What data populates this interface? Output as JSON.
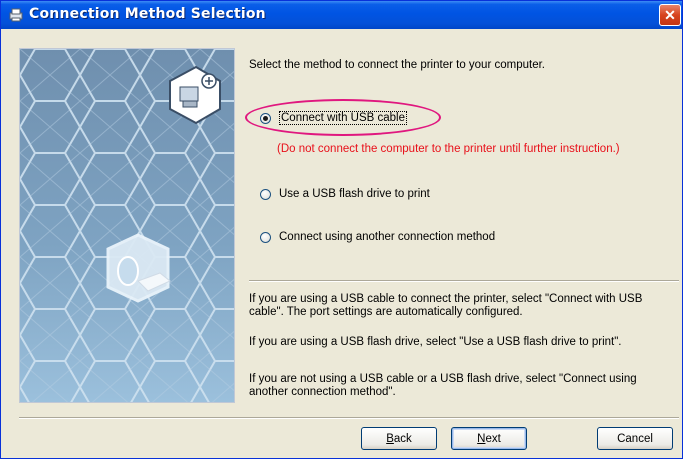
{
  "window": {
    "title": "Connection Method Selection",
    "close_label": "✕"
  },
  "instruction": "Select the method to connect the printer to your computer.",
  "options": [
    {
      "label": "Connect with USB cable",
      "selected": true
    },
    {
      "label": "Use a USB flash drive to print",
      "selected": false
    },
    {
      "label": "Connect using another connection method",
      "selected": false
    }
  ],
  "warning": "(Do not connect the computer to the printer until further instruction.)",
  "help": [
    "If you are using a USB cable to connect the printer, select \"Connect with USB cable\". The port settings are automatically configured.",
    "If you are using a USB flash drive, select \"Use a USB flash drive to print\".",
    "If you are not using a USB cable or a USB flash drive, select \"Connect using another connection method\"."
  ],
  "buttons": {
    "back": {
      "key": "B",
      "rest": "ack"
    },
    "next": {
      "key": "N",
      "rest": "ext"
    },
    "cancel": "Cancel"
  },
  "colors": {
    "highlight_ellipse": "#e0177f",
    "warning_text": "#e8101a",
    "titlebar": "#0054e3"
  }
}
